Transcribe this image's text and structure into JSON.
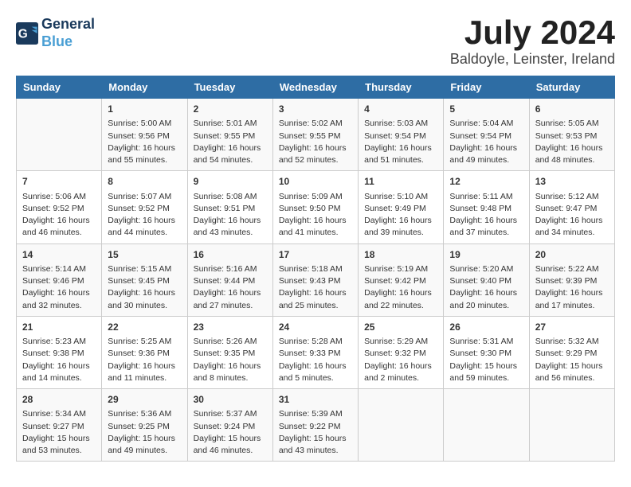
{
  "logo": {
    "line1": "General",
    "line2": "Blue"
  },
  "title": {
    "month_year": "July 2024",
    "location": "Baldoyle, Leinster, Ireland"
  },
  "headers": [
    "Sunday",
    "Monday",
    "Tuesday",
    "Wednesday",
    "Thursday",
    "Friday",
    "Saturday"
  ],
  "weeks": [
    [
      {
        "day": "",
        "info": ""
      },
      {
        "day": "1",
        "info": "Sunrise: 5:00 AM\nSunset: 9:56 PM\nDaylight: 16 hours\nand 55 minutes."
      },
      {
        "day": "2",
        "info": "Sunrise: 5:01 AM\nSunset: 9:55 PM\nDaylight: 16 hours\nand 54 minutes."
      },
      {
        "day": "3",
        "info": "Sunrise: 5:02 AM\nSunset: 9:55 PM\nDaylight: 16 hours\nand 52 minutes."
      },
      {
        "day": "4",
        "info": "Sunrise: 5:03 AM\nSunset: 9:54 PM\nDaylight: 16 hours\nand 51 minutes."
      },
      {
        "day": "5",
        "info": "Sunrise: 5:04 AM\nSunset: 9:54 PM\nDaylight: 16 hours\nand 49 minutes."
      },
      {
        "day": "6",
        "info": "Sunrise: 5:05 AM\nSunset: 9:53 PM\nDaylight: 16 hours\nand 48 minutes."
      }
    ],
    [
      {
        "day": "7",
        "info": "Sunrise: 5:06 AM\nSunset: 9:52 PM\nDaylight: 16 hours\nand 46 minutes."
      },
      {
        "day": "8",
        "info": "Sunrise: 5:07 AM\nSunset: 9:52 PM\nDaylight: 16 hours\nand 44 minutes."
      },
      {
        "day": "9",
        "info": "Sunrise: 5:08 AM\nSunset: 9:51 PM\nDaylight: 16 hours\nand 43 minutes."
      },
      {
        "day": "10",
        "info": "Sunrise: 5:09 AM\nSunset: 9:50 PM\nDaylight: 16 hours\nand 41 minutes."
      },
      {
        "day": "11",
        "info": "Sunrise: 5:10 AM\nSunset: 9:49 PM\nDaylight: 16 hours\nand 39 minutes."
      },
      {
        "day": "12",
        "info": "Sunrise: 5:11 AM\nSunset: 9:48 PM\nDaylight: 16 hours\nand 37 minutes."
      },
      {
        "day": "13",
        "info": "Sunrise: 5:12 AM\nSunset: 9:47 PM\nDaylight: 16 hours\nand 34 minutes."
      }
    ],
    [
      {
        "day": "14",
        "info": "Sunrise: 5:14 AM\nSunset: 9:46 PM\nDaylight: 16 hours\nand 32 minutes."
      },
      {
        "day": "15",
        "info": "Sunrise: 5:15 AM\nSunset: 9:45 PM\nDaylight: 16 hours\nand 30 minutes."
      },
      {
        "day": "16",
        "info": "Sunrise: 5:16 AM\nSunset: 9:44 PM\nDaylight: 16 hours\nand 27 minutes."
      },
      {
        "day": "17",
        "info": "Sunrise: 5:18 AM\nSunset: 9:43 PM\nDaylight: 16 hours\nand 25 minutes."
      },
      {
        "day": "18",
        "info": "Sunrise: 5:19 AM\nSunset: 9:42 PM\nDaylight: 16 hours\nand 22 minutes."
      },
      {
        "day": "19",
        "info": "Sunrise: 5:20 AM\nSunset: 9:40 PM\nDaylight: 16 hours\nand 20 minutes."
      },
      {
        "day": "20",
        "info": "Sunrise: 5:22 AM\nSunset: 9:39 PM\nDaylight: 16 hours\nand 17 minutes."
      }
    ],
    [
      {
        "day": "21",
        "info": "Sunrise: 5:23 AM\nSunset: 9:38 PM\nDaylight: 16 hours\nand 14 minutes."
      },
      {
        "day": "22",
        "info": "Sunrise: 5:25 AM\nSunset: 9:36 PM\nDaylight: 16 hours\nand 11 minutes."
      },
      {
        "day": "23",
        "info": "Sunrise: 5:26 AM\nSunset: 9:35 PM\nDaylight: 16 hours\nand 8 minutes."
      },
      {
        "day": "24",
        "info": "Sunrise: 5:28 AM\nSunset: 9:33 PM\nDaylight: 16 hours\nand 5 minutes."
      },
      {
        "day": "25",
        "info": "Sunrise: 5:29 AM\nSunset: 9:32 PM\nDaylight: 16 hours\nand 2 minutes."
      },
      {
        "day": "26",
        "info": "Sunrise: 5:31 AM\nSunset: 9:30 PM\nDaylight: 15 hours\nand 59 minutes."
      },
      {
        "day": "27",
        "info": "Sunrise: 5:32 AM\nSunset: 9:29 PM\nDaylight: 15 hours\nand 56 minutes."
      }
    ],
    [
      {
        "day": "28",
        "info": "Sunrise: 5:34 AM\nSunset: 9:27 PM\nDaylight: 15 hours\nand 53 minutes."
      },
      {
        "day": "29",
        "info": "Sunrise: 5:36 AM\nSunset: 9:25 PM\nDaylight: 15 hours\nand 49 minutes."
      },
      {
        "day": "30",
        "info": "Sunrise: 5:37 AM\nSunset: 9:24 PM\nDaylight: 15 hours\nand 46 minutes."
      },
      {
        "day": "31",
        "info": "Sunrise: 5:39 AM\nSunset: 9:22 PM\nDaylight: 15 hours\nand 43 minutes."
      },
      {
        "day": "",
        "info": ""
      },
      {
        "day": "",
        "info": ""
      },
      {
        "day": "",
        "info": ""
      }
    ]
  ]
}
